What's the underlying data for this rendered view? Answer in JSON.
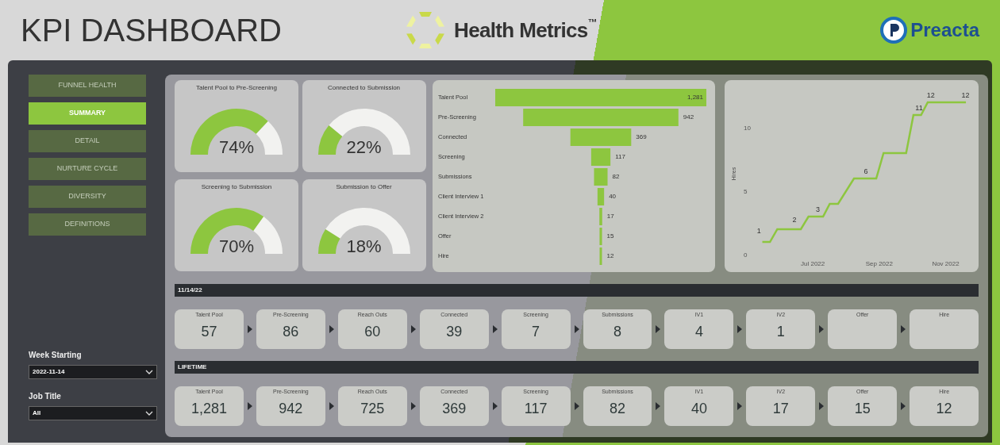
{
  "header": {
    "title": "KPI DASHBOARD",
    "brand": "Health Metrics",
    "brand_mark": "™",
    "partner": "Preacta"
  },
  "nav": [
    {
      "label": "FUNNEL HEALTH",
      "selected": false
    },
    {
      "label": "SUMMARY",
      "selected": true
    },
    {
      "label": "DETAIL",
      "selected": false
    },
    {
      "label": "NURTURE CYCLE",
      "selected": false
    },
    {
      "label": "DIVERSITY",
      "selected": false
    },
    {
      "label": "DEFINITIONS",
      "selected": false
    }
  ],
  "filters": [
    {
      "label": "Week Starting",
      "value": "2022-11-14"
    },
    {
      "label": "Job Title",
      "value": "All"
    }
  ],
  "gauges": [
    {
      "title": "Talent Pool to Pre-Screening",
      "reading": "74%"
    },
    {
      "title": "Connected to Submission",
      "reading": "22%"
    },
    {
      "title": "Screening to Submission",
      "reading": "70%"
    },
    {
      "title": "Submission to Offer",
      "reading": "18%"
    }
  ],
  "funnel": {
    "rows": [
      {
        "label": "Talent Pool",
        "value": "1,281"
      },
      {
        "label": "Pre-Screening",
        "value": "942"
      },
      {
        "label": "Connected",
        "value": "369"
      },
      {
        "label": "Screening",
        "value": "117"
      },
      {
        "label": "Submissions",
        "value": "82"
      },
      {
        "label": "Client Interview 1",
        "value": "40"
      },
      {
        "label": "Client Interview 2",
        "value": "17"
      },
      {
        "label": "Offer",
        "value": "15"
      },
      {
        "label": "Hire",
        "value": "12"
      }
    ]
  },
  "hires": {
    "ylabel": "Hires",
    "yticks": [
      "10",
      "5",
      "0"
    ],
    "xticks": [
      "Jul 2022",
      "Sep 2022",
      "Nov 2022"
    ],
    "point_labels": [
      "1",
      "2",
      "3",
      "6",
      "11",
      "12",
      "12"
    ]
  },
  "sections": [
    {
      "title": "11/14/22",
      "stages": [
        {
          "label": "Talent Pool",
          "value": "57"
        },
        {
          "label": "Pre-Screening",
          "value": "86"
        },
        {
          "label": "Reach Outs",
          "value": "60"
        },
        {
          "label": "Connected",
          "value": "39"
        },
        {
          "label": "Screening",
          "value": "7"
        },
        {
          "label": "Submissions",
          "value": "8"
        },
        {
          "label": "IV1",
          "value": "4"
        },
        {
          "label": "IV2",
          "value": "1"
        },
        {
          "label": "Offer"
        },
        {
          "label": "Hire"
        }
      ]
    },
    {
      "title": "LIFETIME",
      "stages": [
        {
          "label": "Talent Pool",
          "value": "1,281"
        },
        {
          "label": "Pre-Screening",
          "value": "942"
        },
        {
          "label": "Reach Outs",
          "value": "725"
        },
        {
          "label": "Connected",
          "value": "369"
        },
        {
          "label": "Screening",
          "value": "117"
        },
        {
          "label": "Submissions",
          "value": "82"
        },
        {
          "label": "IV1",
          "value": "40"
        },
        {
          "label": "IV2",
          "value": "17"
        },
        {
          "label": "Offer",
          "value": "15"
        },
        {
          "label": "Hire",
          "value": "12"
        }
      ]
    }
  ]
}
